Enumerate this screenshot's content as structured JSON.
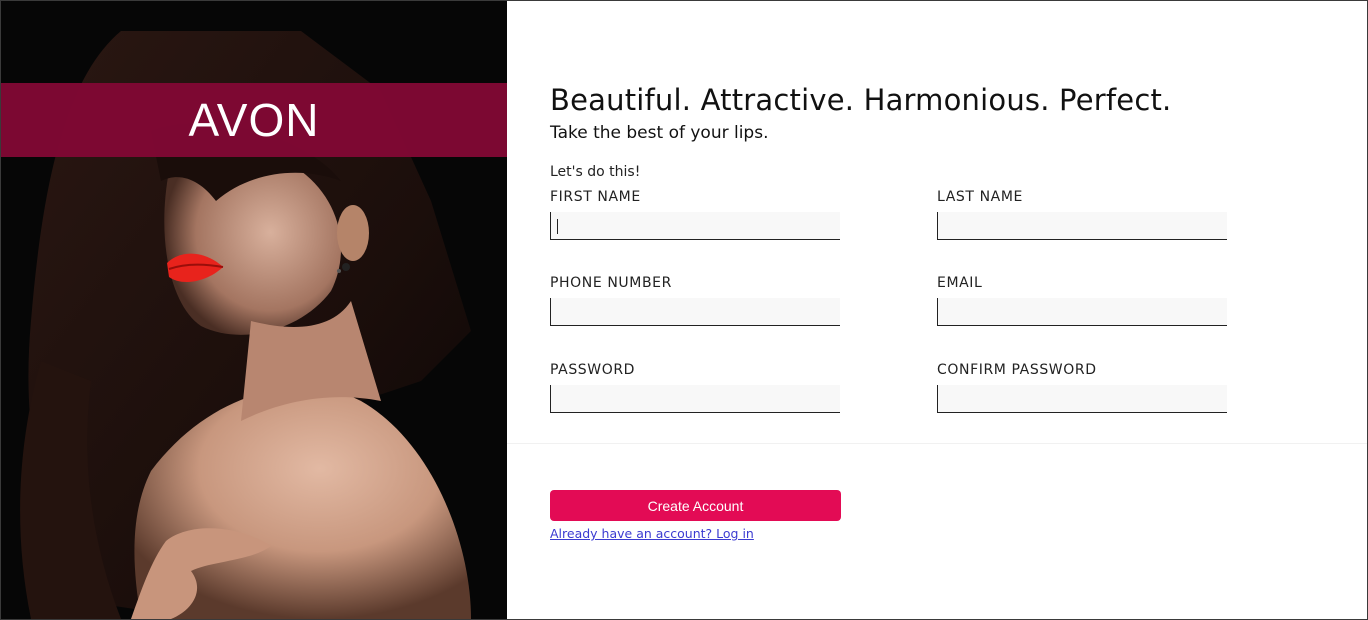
{
  "brand": {
    "logo_text": "AVON",
    "band_color": "#80083a"
  },
  "form": {
    "headline": "Beautiful. Attractive. Harmonious. Perfect.",
    "subheadline": "Take the best of your lips.",
    "intro": "Let's do this!",
    "fields": {
      "first_name": {
        "label": "FIRST NAME",
        "value": ""
      },
      "last_name": {
        "label": "LAST NAME",
        "value": ""
      },
      "phone": {
        "label": "PHONE NUMBER",
        "value": ""
      },
      "email": {
        "label": "EMAIL",
        "value": ""
      },
      "password": {
        "label": "PASSWORD",
        "value": ""
      },
      "confirm_password": {
        "label": "CONFIRM PASSWORD",
        "value": ""
      }
    },
    "submit_label": "Create Account",
    "login_link": "Already have an account? Log in"
  },
  "colors": {
    "accent": "#e30b55",
    "link": "#3b3bd1"
  }
}
